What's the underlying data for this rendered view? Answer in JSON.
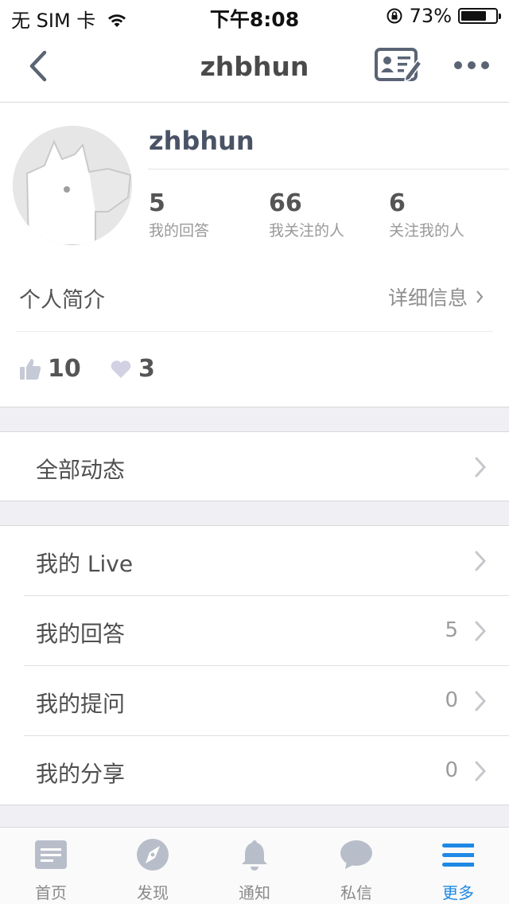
{
  "status_bar": {
    "carrier": "无 SIM 卡",
    "time": "下午8:08",
    "battery": "73%",
    "battery_level": 0.73
  },
  "navbar": {
    "title": "zhbhun",
    "back_icon": "chevron-left-icon",
    "card_icon": "profile-card-edit-icon",
    "more_icon": "more-dots-icon"
  },
  "profile": {
    "name": "zhbhun",
    "stats": [
      {
        "value": "5",
        "label": "我的回答"
      },
      {
        "value": "66",
        "label": "我关注的人"
      },
      {
        "value": "6",
        "label": "关注我的人"
      }
    ],
    "bio_label": "个人简介",
    "bio_link": "详细信息",
    "likes": "10",
    "thanks": "3"
  },
  "menu": {
    "all_activity": "全部动态",
    "items": [
      {
        "label": "我的 Live",
        "count": ""
      },
      {
        "label": "我的回答",
        "count": "5"
      },
      {
        "label": "我的提问",
        "count": "0"
      },
      {
        "label": "我的分享",
        "count": "0"
      }
    ]
  },
  "tabbar": {
    "tabs": [
      {
        "label": "首页",
        "icon": "home-feed-icon"
      },
      {
        "label": "发现",
        "icon": "compass-icon"
      },
      {
        "label": "通知",
        "icon": "bell-icon"
      },
      {
        "label": "私信",
        "icon": "chat-bubble-icon"
      },
      {
        "label": "更多",
        "icon": "menu-lines-icon"
      }
    ],
    "active": "更多"
  },
  "colors": {
    "accent": "#1e88e5",
    "separator": "#efeff4",
    "icon_gray": "#b8bec9"
  }
}
